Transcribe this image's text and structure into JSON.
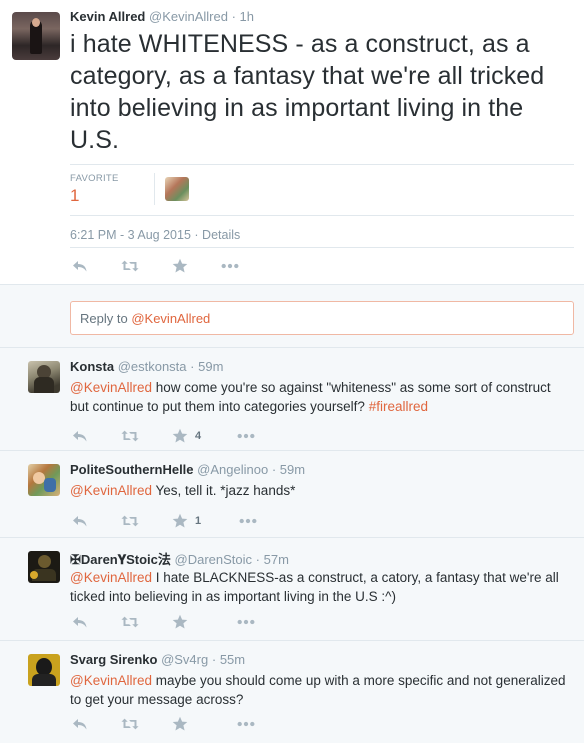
{
  "tweet": {
    "author_name": "Kevin Allred",
    "author_handle": "@KevinAllred",
    "time_ago": "1h",
    "text": "i hate WHITENESS - as a construct, as a category, as a fantasy that we're all tricked into believing in as important living in the U.S.",
    "favorite_label": "FAVORITE",
    "favorite_count": "1",
    "timestamp": "6:21 PM - 3 Aug 2015",
    "details_label": "Details"
  },
  "reply_box": {
    "prefix": "Reply to",
    "handle": "@KevinAllred"
  },
  "replies": [
    {
      "name": "Konsta",
      "handle": "@estkonsta",
      "time": "59m",
      "mention": "@KevinAllred",
      "text": " how come you're so against \"whiteness\" as some sort of construct but continue to put them into categories yourself? ",
      "hashtag": "#fireallred",
      "fav_count": "4"
    },
    {
      "name": "PoliteSouthernHelle",
      "handle": "@Angelinoo",
      "time": "59m",
      "mention": "@KevinAllred",
      "text": " Yes, tell it. *jazz hands*",
      "hashtag": "",
      "fav_count": "1"
    },
    {
      "name": "✠Daren𝐘Stoic法",
      "handle": "@DarenStoic",
      "time": "57m",
      "mention": "@KevinAllred",
      "text": " I hate BLACKNESS-as a construct, a catory, a fantasy that we're all ticked into believing in as important living in the U.S :^)",
      "hashtag": "",
      "fav_count": ""
    },
    {
      "name": "Svarg Sirenko",
      "handle": "@Sv4rg",
      "time": "55m",
      "mention": "@KevinAllred",
      "text": " maybe you should come up with a more specific and not generalized to get your message across?",
      "hashtag": "",
      "fav_count": ""
    }
  ],
  "icons": [
    "reply-icon",
    "retweet-icon",
    "favorite-star-icon",
    "more-dots-icon"
  ],
  "colors": {
    "accent": "#e0663e",
    "muted": "#8899a6",
    "reply_bg": "#f5f8fa",
    "divider": "#e1e8ed"
  }
}
